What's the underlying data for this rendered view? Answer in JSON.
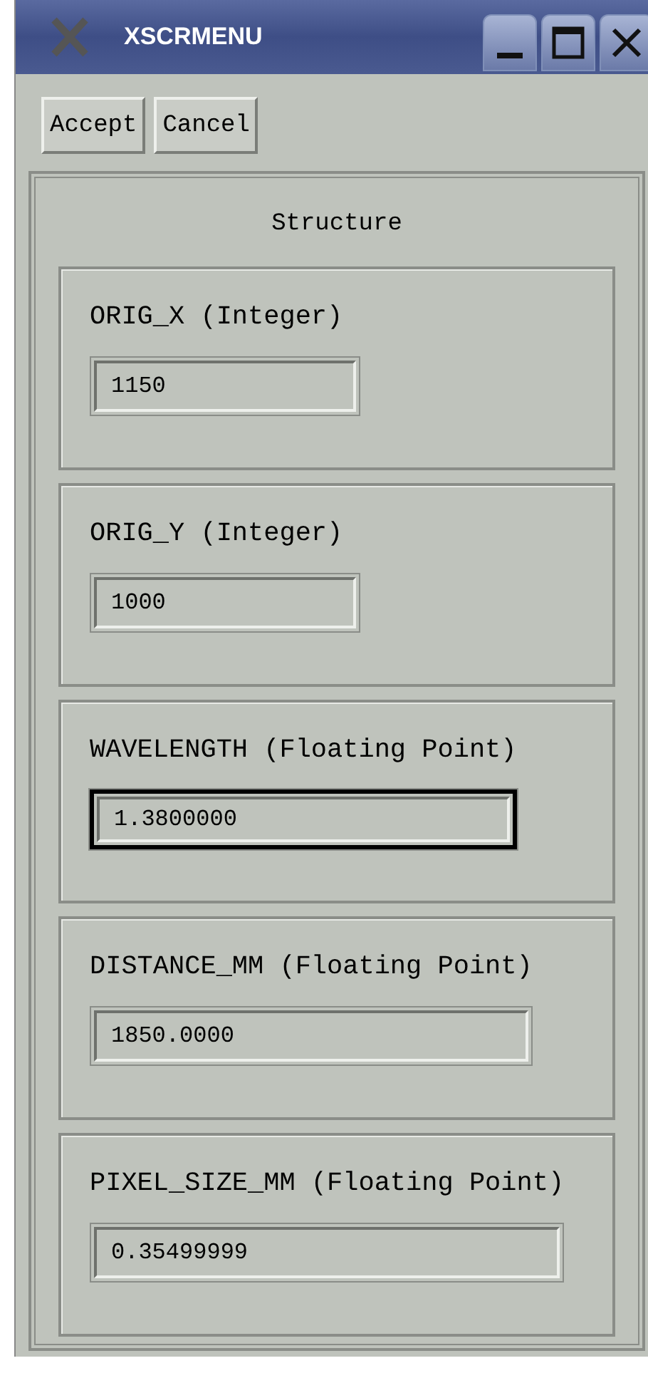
{
  "window": {
    "title": "XSCRMENU"
  },
  "buttons": [
    "Accept",
    "Cancel"
  ],
  "group": {
    "title": "Structure",
    "fields": [
      {
        "label": "ORIG_X (Integer)",
        "value": "1150",
        "focused": false
      },
      {
        "label": "ORIG_Y (Integer)",
        "value": "1000",
        "focused": false
      },
      {
        "label": "WAVELENGTH (Floating Point)",
        "value": "1.3800000",
        "focused": true
      },
      {
        "label": "DISTANCE_MM (Floating Point)",
        "value": "1850.0000",
        "focused": false
      },
      {
        "label": "PIXEL_SIZE_MM (Floating Point)",
        "value": "0.35499999",
        "focused": false
      }
    ]
  }
}
